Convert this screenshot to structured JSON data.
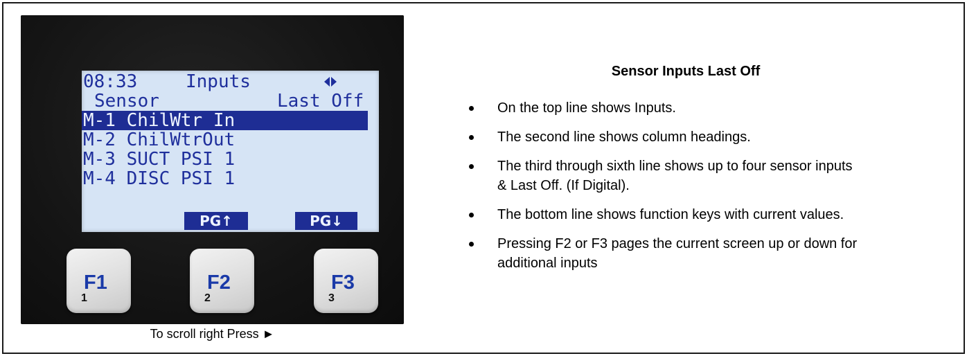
{
  "device": {
    "lcd": {
      "time": "08:33",
      "screen_title": "Inputs",
      "col_sensor": "Sensor",
      "col_last_off": "Last Off",
      "rows": [
        "M-1 ChilWtr In",
        "M-2 ChilWtrOut",
        "M-3 SUCT PSI 1",
        "M-4 DISC PSI 1"
      ],
      "softkey_up": "PG↑",
      "softkey_down": "PG↓"
    },
    "keys": [
      {
        "label": "F1",
        "num": "1"
      },
      {
        "label": "F2",
        "num": "2"
      },
      {
        "label": "F3",
        "num": "3"
      }
    ]
  },
  "caption": "To scroll right Press ►",
  "description": {
    "title": "Sensor Inputs Last Off",
    "bullets": [
      "On the top line shows Inputs.",
      "The second line shows column headings.",
      "The third through sixth line shows up to four sensor inputs & Last Off. (If Digital).",
      "The bottom line shows function keys with current values.",
      "Pressing F2 or F3 pages the current screen up or down for additional inputs"
    ]
  }
}
